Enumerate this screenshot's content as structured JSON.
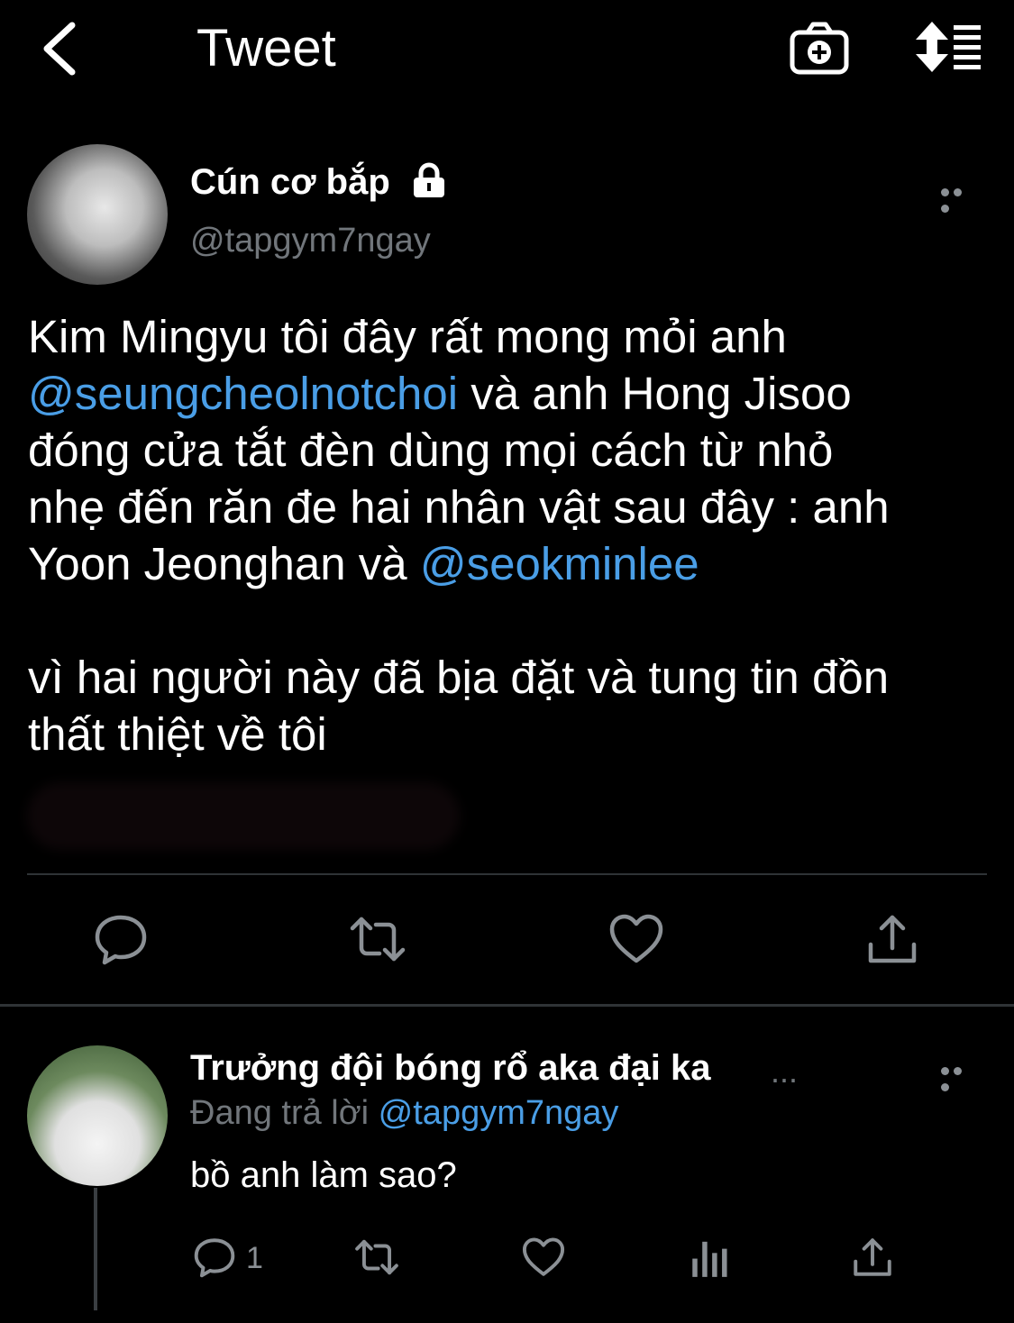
{
  "header": {
    "title": "Tweet"
  },
  "tweet": {
    "author_name": "Cún cơ bắp",
    "author_handle": "@tapgym7ngay",
    "text_part1": "Kim Mingyu tôi đây rất mong mỏi anh\n",
    "mention1": "@seungcheolnotchoi",
    "text_part2": " và anh Hong Jisoo\nđóng cửa tắt đèn dùng mọi cách từ nhỏ\nnhẹ đến răn đe hai nhân vật sau đây : anh\nYoon Jeonghan và ",
    "mention2": "@seokminlee",
    "text_part3": "\n\nvì hai người này đã bịa đặt và tung tin đồn\nthất thiệt về tôi",
    "icons": [
      "reply-icon",
      "retweet-icon",
      "like-icon",
      "share-icon"
    ]
  },
  "reply": {
    "author_name": "Trưởng đội bóng rổ aka đại ka",
    "truncation": "...",
    "replying_prefix": "Đang trả lời",
    "replying_to": "@tapgym7ngay",
    "text": "bồ anh làm sao?",
    "reply_count": "1",
    "icons": [
      "reply-icon",
      "retweet-icon",
      "like-icon",
      "stats-icon",
      "share-icon"
    ]
  },
  "colors": {
    "background": "#000000",
    "mention": "#4a9ee6",
    "muted": "#71767b"
  }
}
